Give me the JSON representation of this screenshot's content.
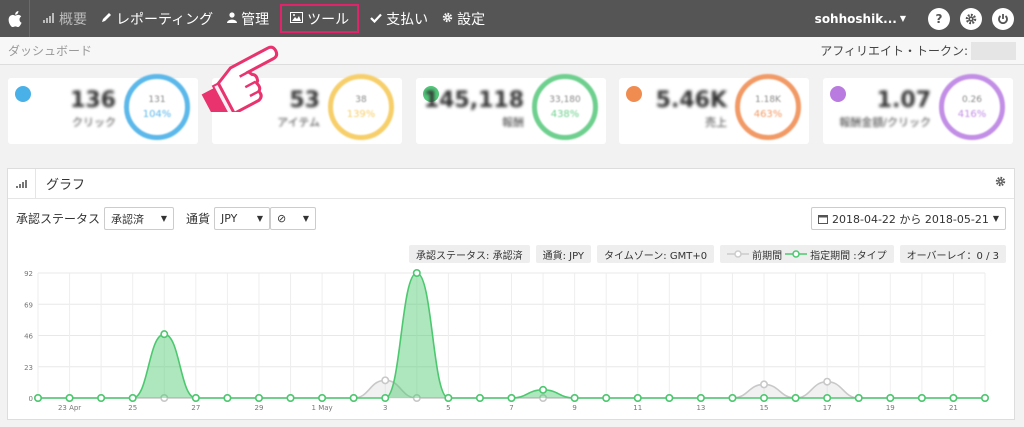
{
  "nav": {
    "items": [
      {
        "icon": "bar-chart-icon",
        "label": "概要"
      },
      {
        "icon": "pencil-icon",
        "label": "レポーティング"
      },
      {
        "icon": "user-icon",
        "label": "管理"
      },
      {
        "icon": "image-icon",
        "label": "ツール"
      },
      {
        "icon": "check-icon",
        "label": "支払い"
      },
      {
        "icon": "gear-icon",
        "label": "設定"
      }
    ],
    "username": "sohhoshik...",
    "help_glyph": "?",
    "power_glyph": "⏻"
  },
  "subheader": {
    "breadcrumb": "ダッシュボード",
    "token_label": "アフィリエイト・トークン:"
  },
  "cards": [
    {
      "value": "136",
      "label": "クリック",
      "ring_top": "131",
      "ring_pct": "104%",
      "badge_color": "#4ab1e8",
      "ring_color": "#5bb8ea"
    },
    {
      "value": "53",
      "label": "アイテム",
      "ring_top": "38",
      "ring_pct": "139%",
      "badge_color": "#f5c95b",
      "ring_color": "#f7cf6a"
    },
    {
      "value": "145,118",
      "label": "報酬",
      "ring_top": "33,180",
      "ring_pct": "438%",
      "badge_color": "#52c77a",
      "ring_color": "#6ed08e"
    },
    {
      "value": "5.46K",
      "label": "売上",
      "ring_top": "1.18K",
      "ring_pct": "463%",
      "badge_color": "#f08c50",
      "ring_color": "#f29a66"
    },
    {
      "value": "1.07",
      "label": "報酬金額/クリック",
      "ring_top": "0.26",
      "ring_pct": "416%",
      "badge_color": "#b97be0",
      "ring_color": "#c28ee6"
    }
  ],
  "graph": {
    "title": "グラフ",
    "filters": {
      "status_label": "承認ステータス",
      "status_value": "承認済",
      "currency_label": "通貨",
      "currency_value": "JPY",
      "extra_value": "⊘"
    },
    "date_range": "2018-04-22 から 2018-05-21",
    "pills": {
      "status": "承認ステータス: 承認済",
      "currency": "通貨: JPY",
      "timezone": "タイムゾーン: GMT+0",
      "previous": "前期間",
      "current": "指定期間 :タイプ",
      "overlay": "オーバーレイ：0 / 3"
    }
  },
  "chart_data": {
    "type": "area",
    "y_ticks": [
      0,
      23,
      46,
      69,
      92
    ],
    "ylim": [
      0,
      92
    ],
    "x_tick_labels": [
      "23 Apr",
      "25",
      "27",
      "29",
      "1 May",
      "3",
      "5",
      "7",
      "9",
      "11",
      "13",
      "15",
      "17",
      "19",
      "21"
    ],
    "x_tick_positions": [
      1,
      3,
      5,
      7,
      9,
      11,
      13,
      15,
      17,
      19,
      21,
      23,
      25,
      27,
      29
    ],
    "colors": {
      "current": "#4cc86f",
      "previous": "#c8c8c8"
    },
    "series": [
      {
        "name": "指定期間",
        "values": [
          0,
          0,
          0,
          0,
          47,
          0,
          0,
          0,
          0,
          0,
          0,
          0,
          92,
          0,
          0,
          0,
          6,
          0,
          0,
          0,
          0,
          0,
          0,
          0,
          0,
          0,
          0,
          0,
          0,
          0,
          0
        ]
      },
      {
        "name": "前期間",
        "values": [
          0,
          0,
          0,
          0,
          0,
          0,
          0,
          0,
          0,
          0,
          0,
          13,
          0,
          0,
          0,
          0,
          0,
          0,
          0,
          0,
          0,
          0,
          0,
          10,
          0,
          12,
          0,
          0,
          0,
          0,
          0
        ]
      }
    ]
  }
}
